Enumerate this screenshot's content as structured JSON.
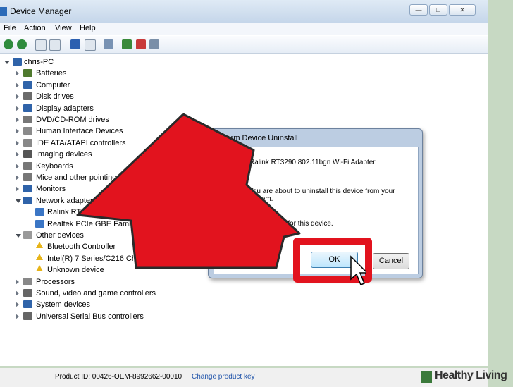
{
  "window": {
    "title": "Device Manager",
    "controls": [
      "—",
      "□",
      "✕"
    ]
  },
  "menu": [
    "File",
    "Action",
    "View",
    "Help"
  ],
  "toolbar": {
    "icons": [
      "back-icon",
      "forward-icon",
      "properties-icon",
      "view-icon",
      "help-icon",
      "view-hidden-icon",
      "scan-hardware-icon",
      "update-driver-icon",
      "uninstall-icon",
      "disable-icon"
    ]
  },
  "tree": {
    "root": "chris-PC",
    "items": [
      {
        "label": "Batteries",
        "level": 1,
        "expanded": false,
        "icon": "battery-icon",
        "color": "#4f7a2e"
      },
      {
        "label": "Computer",
        "level": 1,
        "expanded": false,
        "icon": "computer-icon",
        "color": "#2f63a9"
      },
      {
        "label": "Disk drives",
        "level": 1,
        "expanded": false,
        "icon": "disk-icon",
        "color": "#6b6b6b"
      },
      {
        "label": "Display adapters",
        "level": 1,
        "expanded": false,
        "icon": "display-icon",
        "color": "#2f63a9"
      },
      {
        "label": "DVD/CD-ROM drives",
        "level": 1,
        "expanded": false,
        "icon": "dvd-icon",
        "color": "#777777"
      },
      {
        "label": "Human Interface Devices",
        "level": 1,
        "expanded": false,
        "icon": "hid-icon",
        "color": "#8a8a8a"
      },
      {
        "label": "IDE ATA/ATAPI controllers",
        "level": 1,
        "expanded": false,
        "icon": "ide-icon",
        "color": "#888888"
      },
      {
        "label": "Imaging devices",
        "level": 1,
        "expanded": false,
        "icon": "camera-icon",
        "color": "#555555"
      },
      {
        "label": "Keyboards",
        "level": 1,
        "expanded": false,
        "icon": "keyboard-icon",
        "color": "#777777"
      },
      {
        "label": "Mice and other pointing devices",
        "level": 1,
        "expanded": false,
        "icon": "mouse-icon",
        "color": "#777777"
      },
      {
        "label": "Monitors",
        "level": 1,
        "expanded": false,
        "icon": "monitor-icon",
        "color": "#2f63a9"
      },
      {
        "label": "Network adapters",
        "level": 1,
        "expanded": true,
        "icon": "network-icon",
        "color": "#2f63a9"
      },
      {
        "label": "Ralink RT3290 802.11bgn Wi-Fi Adapter",
        "level": 2,
        "icon": "network-card-icon",
        "color": "#3b76c5"
      },
      {
        "label": "Realtek PCIe GBE Family Controller",
        "level": 2,
        "icon": "network-card-icon",
        "color": "#3b76c5"
      },
      {
        "label": "Other devices",
        "level": 1,
        "expanded": true,
        "icon": "other-devices-icon",
        "color": "#9a9a9a"
      },
      {
        "label": "Bluetooth Controller",
        "level": 2,
        "icon": "warning-icon",
        "warn": true
      },
      {
        "label": "Intel(R) 7 Series/C216 Chipset Family USB 3.0 eXtensible Host Controller",
        "level": 2,
        "icon": "warning-icon",
        "warn": true
      },
      {
        "label": "Unknown device",
        "level": 2,
        "icon": "warning-icon",
        "warn": true
      },
      {
        "label": "Processors",
        "level": 1,
        "expanded": false,
        "icon": "processor-icon",
        "color": "#888888"
      },
      {
        "label": "Sound, video and game controllers",
        "level": 1,
        "expanded": false,
        "icon": "sound-icon",
        "color": "#666666"
      },
      {
        "label": "System devices",
        "level": 1,
        "expanded": false,
        "icon": "system-icon",
        "color": "#2f63a9"
      },
      {
        "label": "Universal Serial Bus controllers",
        "level": 1,
        "expanded": false,
        "icon": "usb-icon",
        "color": "#666666"
      }
    ]
  },
  "status": {
    "product_id": "Product ID: 00426-OEM-8992662-00010",
    "change_key": "Change product key"
  },
  "dialog": {
    "title": "Confirm Device Uninstall",
    "device": "Ralink RT3290 802.11bgn Wi-Fi Adapter",
    "message": "You are about to uninstall this device from your system.",
    "checkbox_fragment": "er software for this device.",
    "ok": "OK",
    "cancel": "Cancel"
  },
  "annotation": {
    "arrow_color": "#e2131e",
    "highlight_color": "#e2131e"
  },
  "watermark": "Healthy Living"
}
